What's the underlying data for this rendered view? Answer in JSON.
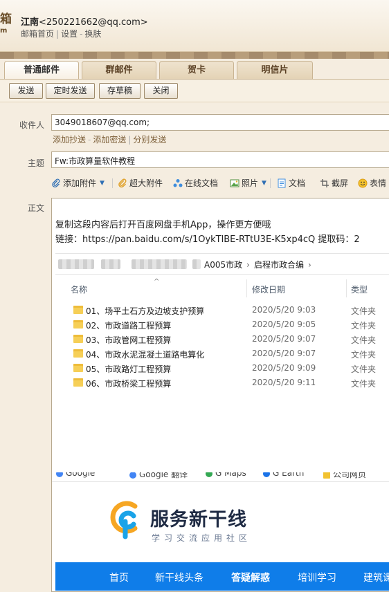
{
  "header": {
    "logo_char": "箱",
    "logo_sub": "m",
    "user_name": "江南",
    "user_email": "<250221662@qq.com>",
    "links": [
      "邮箱首页",
      "设置",
      "换肤"
    ]
  },
  "tabs": [
    "普通邮件",
    "群邮件",
    "贺卡",
    "明信片"
  ],
  "toolbar": {
    "send": "发送",
    "schedule": "定时发送",
    "draft": "存草稿",
    "close": "关闭"
  },
  "compose": {
    "to_label": "收件人",
    "to_value": "3049018607@qq.com;",
    "cc_links": [
      "添加抄送",
      "添加密送",
      "分别发送"
    ],
    "subject_label": "主题",
    "subject_value": "Fw:市政算量软件教程",
    "body_label": "正文"
  },
  "editor_toolbar": {
    "attach": "添加附件",
    "big_attach": "超大附件",
    "online_doc": "在线文档",
    "photo": "照片",
    "doc": "文档",
    "screenshot": "截屏",
    "emoji": "表情"
  },
  "body": {
    "line1": "复制这段内容后打开百度网盘手机App，操作更方便哦",
    "line2": "链接：https://pan.baidu.com/s/1OykTlBE-RTtU3E-K5xp4cQ 提取码：2"
  },
  "explorer": {
    "breadcrumb": [
      "A005市政",
      "启程市政合编"
    ],
    "columns": {
      "name": "名称",
      "date": "修改日期",
      "type": "类型"
    },
    "rows": [
      {
        "name": "01、场平土石方及边坡支护预算",
        "date": "2020/5/20 9:03",
        "type": "文件夹"
      },
      {
        "name": "02、市政道路工程预算",
        "date": "2020/5/20 9:05",
        "type": "文件夹"
      },
      {
        "name": "03、市政管网工程预算",
        "date": "2020/5/20 9:07",
        "type": "文件夹"
      },
      {
        "name": "04、市政水泥混凝土道路电算化",
        "date": "2020/5/20 9:07",
        "type": "文件夹"
      },
      {
        "name": "05、市政路灯工程预算",
        "date": "2020/5/20 9:09",
        "type": "文件夹"
      },
      {
        "name": "06、市政桥梁工程预算",
        "date": "2020/5/20 9:11",
        "type": "文件夹"
      }
    ]
  },
  "bookmarks": [
    "Google",
    "Google 翻译",
    "G Maps",
    "G Earth",
    "公司网页"
  ],
  "brand": {
    "name": "服务新干线",
    "tagline": "学习交流应用社区",
    "color": "#0f7de9"
  },
  "site_nav": [
    "首页",
    "新干线头条",
    "答疑解惑",
    "培训学习",
    "建筑课"
  ]
}
